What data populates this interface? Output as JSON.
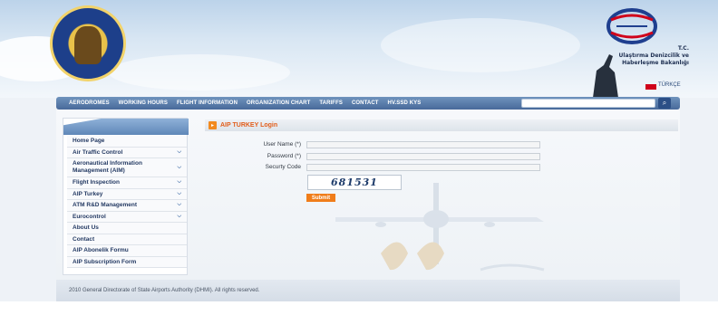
{
  "header": {
    "ministry_line1": "T.C.",
    "ministry_line2": "Ulaştırma Denizcilik ve",
    "ministry_line3": "Haberleşme Bakanlığı",
    "language_label": "TÜRKÇE"
  },
  "nav": {
    "items": [
      "AERODROMES",
      "WORKING HOURS",
      "FLIGHT INFORMATION",
      "ORGANIZATION CHART",
      "TARIFFS",
      "CONTACT",
      "HV.SSD KYS"
    ],
    "search_placeholder": "",
    "search_icon": "magnifier-icon"
  },
  "sidebar": {
    "items": [
      {
        "label": "Home Page",
        "has_submenu": false
      },
      {
        "label": "Air Traffic Control",
        "has_submenu": true
      },
      {
        "label": "Aeronautical Information Management (AIM)",
        "has_submenu": true
      },
      {
        "label": "Flight Inspection",
        "has_submenu": true
      },
      {
        "label": "AIP Turkey",
        "has_submenu": true
      },
      {
        "label": "ATM R&D Management",
        "has_submenu": true
      },
      {
        "label": "Eurocontrol",
        "has_submenu": true
      },
      {
        "label": "About Us",
        "has_submenu": false
      },
      {
        "label": "Contact",
        "has_submenu": false
      },
      {
        "label": "AIP Abonelik Formu",
        "has_submenu": false
      },
      {
        "label": "AIP Subscription Form",
        "has_submenu": false
      }
    ]
  },
  "login": {
    "title": "AIP TURKEY Login",
    "username_label": "User Name (*)",
    "password_label": "Password (*)",
    "security_label": "Securty Code",
    "username_value": "",
    "password_value": "",
    "security_value": "",
    "captcha_text": "681531",
    "submit_label": "Submit"
  },
  "footer": {
    "copyright": "2010 General Directorate of State Airports Authority (DHMI). All rights reserved."
  },
  "colors": {
    "nav_bg": "#48699a",
    "accent_orange": "#f07d1a",
    "title_orange": "#e25d1a",
    "menu_text": "#243a63"
  }
}
